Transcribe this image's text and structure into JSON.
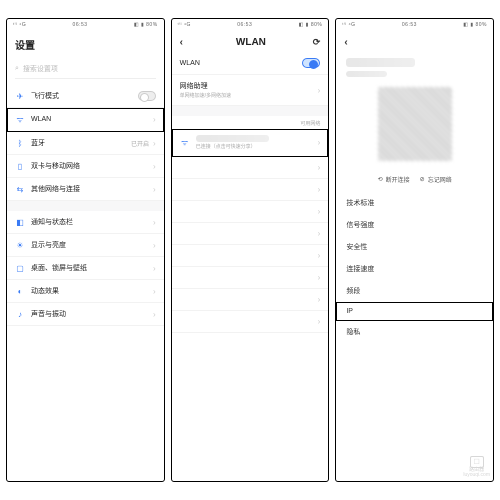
{
  "status": {
    "left": "ᵗⁱˡ ⁴G",
    "center": "06:53",
    "right": "◧ ▮ 80%"
  },
  "settings": {
    "title": "设置",
    "search_placeholder": "搜索设置项",
    "airplane": "飞行模式",
    "wlan": "WLAN",
    "bluetooth": "蓝牙",
    "bluetooth_state": "已开启",
    "sim": "双卡与移动网络",
    "other_net": "其他网络与连接",
    "notif": "通知与状态栏",
    "display": "显示与亮度",
    "wallpaper": "桌面、锁屏与壁纸",
    "dynamic": "动态效果",
    "sound": "声音与振动"
  },
  "wlan": {
    "title": "WLAN",
    "switch_label": "WLAN",
    "assist_title": "网络助理",
    "assist_sub": "单网络加速/多网络加速",
    "connected_sub": "已连接（点击可快速分享）",
    "available_header": "可用网络"
  },
  "detail": {
    "reconnect": "断开连接",
    "forget": "忘记网络",
    "tech": "技术标准",
    "signal": "信号强度",
    "security": "安全性",
    "speed": "连接速度",
    "freq": "频段",
    "ip": "IP",
    "privacy": "隐私"
  },
  "watermark": {
    "brand": "路由器",
    "domain": "luyouqi.com"
  }
}
